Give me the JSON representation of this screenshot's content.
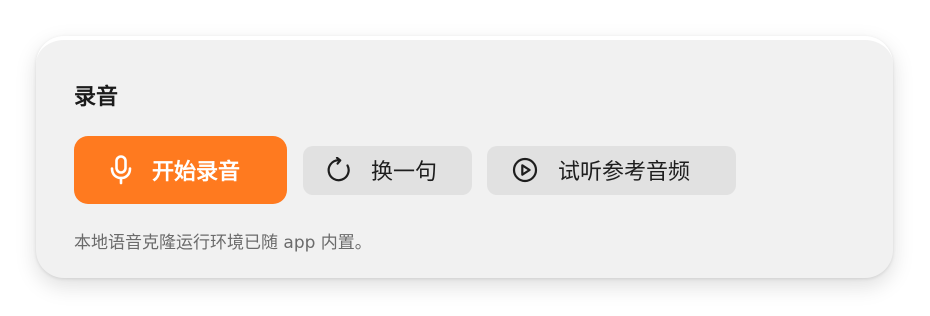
{
  "recording_panel": {
    "title": "录音",
    "accent_color": "#ff7a1f",
    "buttons": {
      "start_recording": {
        "label": "开始录音",
        "icon": "microphone-icon"
      },
      "swap_sentence": {
        "label": "换一句",
        "icon": "refresh-icon"
      },
      "listen_reference": {
        "label": "试听参考音频",
        "icon": "play-circle-icon"
      }
    },
    "note": "本地语音克隆运行环境已随 app 内置。"
  }
}
